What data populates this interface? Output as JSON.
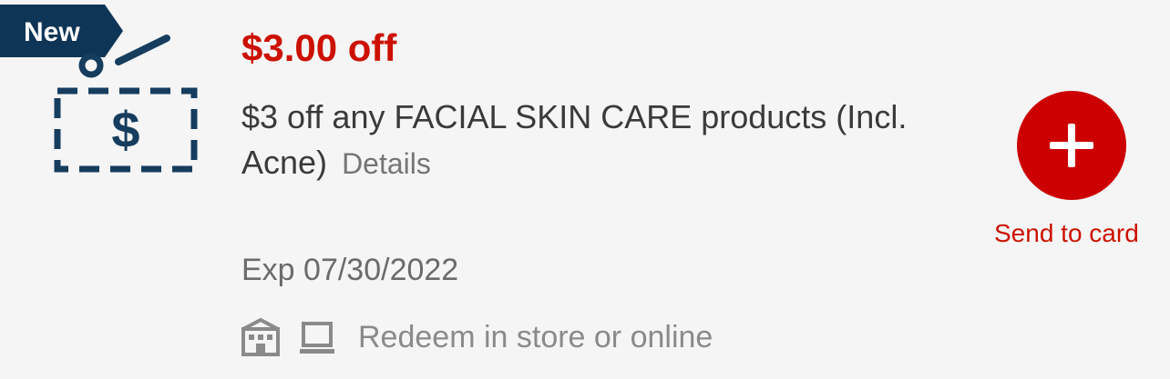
{
  "badge": {
    "label": "New"
  },
  "coupon": {
    "amount": "$3.00 off",
    "description": "$3 off any FACIAL SKIN CARE products (Incl. Acne)",
    "details_label": "Details",
    "expiry": "Exp 07/30/2022",
    "redeem_text": "Redeem in store or online",
    "icon": "coupon-dollar-scissors-icon"
  },
  "action": {
    "send_label": "Send to card",
    "icon": "plus-icon"
  },
  "colors": {
    "accent_red": "#cc0000",
    "badge_navy": "#0f3556",
    "text_dark": "#3a3a3a",
    "text_muted": "#757575",
    "background": "#f5f5f5"
  }
}
